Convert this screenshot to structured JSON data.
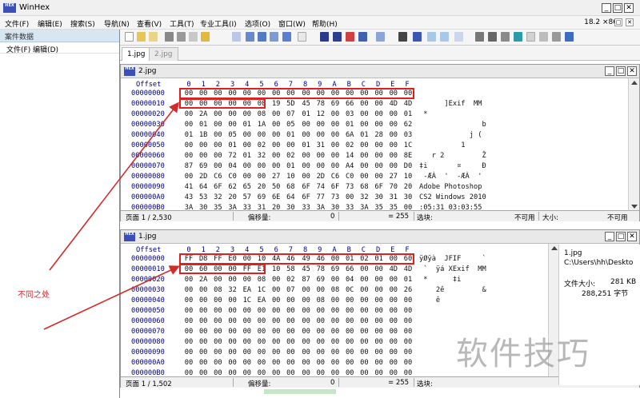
{
  "app": {
    "title": "WinHex",
    "version": "18.2 ×86",
    "icon_text": "HEX"
  },
  "menu": [
    "文件(F)",
    "编辑(E)",
    "搜索(S)",
    "导航(N)",
    "查看(V)",
    "工具(T)",
    "专业工具(I)",
    "选项(O)",
    "窗口(W)",
    "帮助(H)"
  ],
  "sidebar": {
    "title": "案件数据",
    "menu": "文件(F)  编辑(D)"
  },
  "tabs": [
    "1.jpg",
    "2.jpg"
  ],
  "columns": [
    "0",
    "1",
    "2",
    "3",
    "4",
    "5",
    "6",
    "7",
    "8",
    "9",
    "A",
    "B",
    "C",
    "D",
    "E",
    "F"
  ],
  "offset_header": "Offset",
  "pane_top": {
    "title": "2.jpg",
    "rows": [
      {
        "off": "00000000",
        "bytes": [
          "00",
          "00",
          "00",
          "00",
          "00",
          "00",
          "00",
          "00",
          "00",
          "00",
          "00",
          "00",
          "00",
          "00",
          "00",
          "00"
        ],
        "ascii": ""
      },
      {
        "off": "00000010",
        "bytes": [
          "00",
          "00",
          "00",
          "00",
          "00",
          "00",
          "19",
          "5D",
          "45",
          "78",
          "69",
          "66",
          "00",
          "00",
          "4D",
          "4D"
        ],
        "ascii": "      ]Exif  MM"
      },
      {
        "off": "00000020",
        "bytes": [
          "00",
          "2A",
          "00",
          "00",
          "00",
          "08",
          "00",
          "07",
          "01",
          "12",
          "00",
          "03",
          "00",
          "00",
          "00",
          "01"
        ],
        "ascii": " *"
      },
      {
        "off": "00000030",
        "bytes": [
          "00",
          "01",
          "00",
          "00",
          "01",
          "1A",
          "00",
          "05",
          "00",
          "00",
          "00",
          "01",
          "00",
          "00",
          "00",
          "62"
        ],
        "ascii": "               b"
      },
      {
        "off": "00000040",
        "bytes": [
          "01",
          "1B",
          "00",
          "05",
          "00",
          "00",
          "00",
          "01",
          "00",
          "00",
          "00",
          "6A",
          "01",
          "28",
          "00",
          "03"
        ],
        "ascii": "            j ("
      },
      {
        "off": "00000050",
        "bytes": [
          "00",
          "00",
          "00",
          "01",
          "00",
          "02",
          "00",
          "00",
          "01",
          "31",
          "00",
          "02",
          "00",
          "00",
          "00",
          "1C"
        ],
        "ascii": "          1"
      },
      {
        "off": "00000060",
        "bytes": [
          "00",
          "00",
          "00",
          "72",
          "01",
          "32",
          "00",
          "02",
          "00",
          "00",
          "00",
          "14",
          "00",
          "00",
          "00",
          "8E"
        ],
        "ascii": "   r 2         Ž"
      },
      {
        "off": "00000070",
        "bytes": [
          "87",
          "69",
          "00",
          "04",
          "00",
          "00",
          "00",
          "01",
          "00",
          "00",
          "00",
          "A4",
          "00",
          "00",
          "00",
          "D0"
        ],
        "ascii": "‡i       ¤     Ð"
      },
      {
        "off": "00000080",
        "bytes": [
          "00",
          "2D",
          "C6",
          "C0",
          "00",
          "00",
          "27",
          "10",
          "00",
          "2D",
          "C6",
          "C0",
          "00",
          "00",
          "27",
          "10"
        ],
        "ascii": " -ÆÀ  '  -ÆÀ  '"
      },
      {
        "off": "00000090",
        "bytes": [
          "41",
          "64",
          "6F",
          "62",
          "65",
          "20",
          "50",
          "68",
          "6F",
          "74",
          "6F",
          "73",
          "68",
          "6F",
          "70",
          "20"
        ],
        "ascii": "Adobe Photoshop"
      },
      {
        "off": "000000A0",
        "bytes": [
          "43",
          "53",
          "32",
          "20",
          "57",
          "69",
          "6E",
          "64",
          "6F",
          "77",
          "73",
          "00",
          "32",
          "30",
          "31",
          "30"
        ],
        "ascii": "CS2 Windows 2010"
      },
      {
        "off": "000000B0",
        "bytes": [
          "3A",
          "30",
          "35",
          "3A",
          "33",
          "31",
          "20",
          "30",
          "33",
          "3A",
          "30",
          "33",
          "3A",
          "35",
          "35",
          "00"
        ],
        "ascii": ":05:31 03:03:55"
      }
    ],
    "status": {
      "page": "页面 1 / 2,530",
      "offset_label": "偏移量:",
      "offset_value": "0",
      "eq": "= 255",
      "sel_label": "选块:",
      "na1": "不可用",
      "size_label": "大小:",
      "na2": "不可用"
    }
  },
  "pane_bottom": {
    "title": "1.jpg",
    "rows": [
      {
        "off": "00000000",
        "bytes": [
          "FF",
          "D8",
          "FF",
          "E0",
          "00",
          "10",
          "4A",
          "46",
          "49",
          "46",
          "00",
          "01",
          "02",
          "01",
          "00",
          "60"
        ],
        "ascii": "ÿØÿà  JFIF     `"
      },
      {
        "off": "00000010",
        "bytes": [
          "00",
          "60",
          "00",
          "00",
          "FF",
          "E1",
          "10",
          "58",
          "45",
          "78",
          "69",
          "66",
          "00",
          "00",
          "4D",
          "4D"
        ],
        "ascii": " `  ÿá XExif  MM"
      },
      {
        "off": "00000020",
        "bytes": [
          "00",
          "2A",
          "00",
          "00",
          "00",
          "08",
          "00",
          "02",
          "87",
          "69",
          "00",
          "04",
          "00",
          "00",
          "00",
          "01"
        ],
        "ascii": " *      ‡i"
      },
      {
        "off": "00000030",
        "bytes": [
          "00",
          "00",
          "08",
          "32",
          "EA",
          "1C",
          "00",
          "07",
          "00",
          "00",
          "08",
          "0C",
          "00",
          "00",
          "00",
          "26"
        ],
        "ascii": "    2ê         &"
      },
      {
        "off": "00000040",
        "bytes": [
          "00",
          "00",
          "00",
          "00",
          "1C",
          "EA",
          "00",
          "00",
          "00",
          "08",
          "00",
          "00",
          "00",
          "00",
          "00",
          "00"
        ],
        "ascii": "    ê"
      },
      {
        "off": "00000050",
        "bytes": [
          "00",
          "00",
          "00",
          "00",
          "00",
          "00",
          "00",
          "00",
          "00",
          "00",
          "00",
          "00",
          "00",
          "00",
          "00",
          "00"
        ],
        "ascii": ""
      },
      {
        "off": "00000060",
        "bytes": [
          "00",
          "00",
          "00",
          "00",
          "00",
          "00",
          "00",
          "00",
          "00",
          "00",
          "00",
          "00",
          "00",
          "00",
          "00",
          "00"
        ],
        "ascii": ""
      },
      {
        "off": "00000070",
        "bytes": [
          "00",
          "00",
          "00",
          "00",
          "00",
          "00",
          "00",
          "00",
          "00",
          "00",
          "00",
          "00",
          "00",
          "00",
          "00",
          "00"
        ],
        "ascii": ""
      },
      {
        "off": "00000080",
        "bytes": [
          "00",
          "00",
          "00",
          "00",
          "00",
          "00",
          "00",
          "00",
          "00",
          "00",
          "00",
          "00",
          "00",
          "00",
          "00",
          "00"
        ],
        "ascii": ""
      },
      {
        "off": "00000090",
        "bytes": [
          "00",
          "00",
          "00",
          "00",
          "00",
          "00",
          "00",
          "00",
          "00",
          "00",
          "00",
          "00",
          "00",
          "00",
          "00",
          "00"
        ],
        "ascii": ""
      },
      {
        "off": "000000A0",
        "bytes": [
          "00",
          "00",
          "00",
          "00",
          "00",
          "00",
          "00",
          "00",
          "00",
          "00",
          "00",
          "00",
          "00",
          "00",
          "00",
          "00"
        ],
        "ascii": ""
      },
      {
        "off": "000000B0",
        "bytes": [
          "00",
          "00",
          "00",
          "00",
          "00",
          "00",
          "00",
          "00",
          "00",
          "00",
          "00",
          "00",
          "00",
          "00",
          "00",
          "00"
        ],
        "ascii": ""
      }
    ],
    "status": {
      "page": "页面 1 / 1,502",
      "offset_label": "偏移量:",
      "offset_value": "0",
      "eq": "= 255",
      "sel_label": "选块:"
    }
  },
  "info": {
    "filename": "1.jpg",
    "path": "C:\\Users\\hh\\Deskto",
    "size_label": "文件大小:",
    "size_kb": "281 KB",
    "size_bytes": "288,251 字节"
  },
  "annotation": "不同之处",
  "watermark": "软件技巧"
}
